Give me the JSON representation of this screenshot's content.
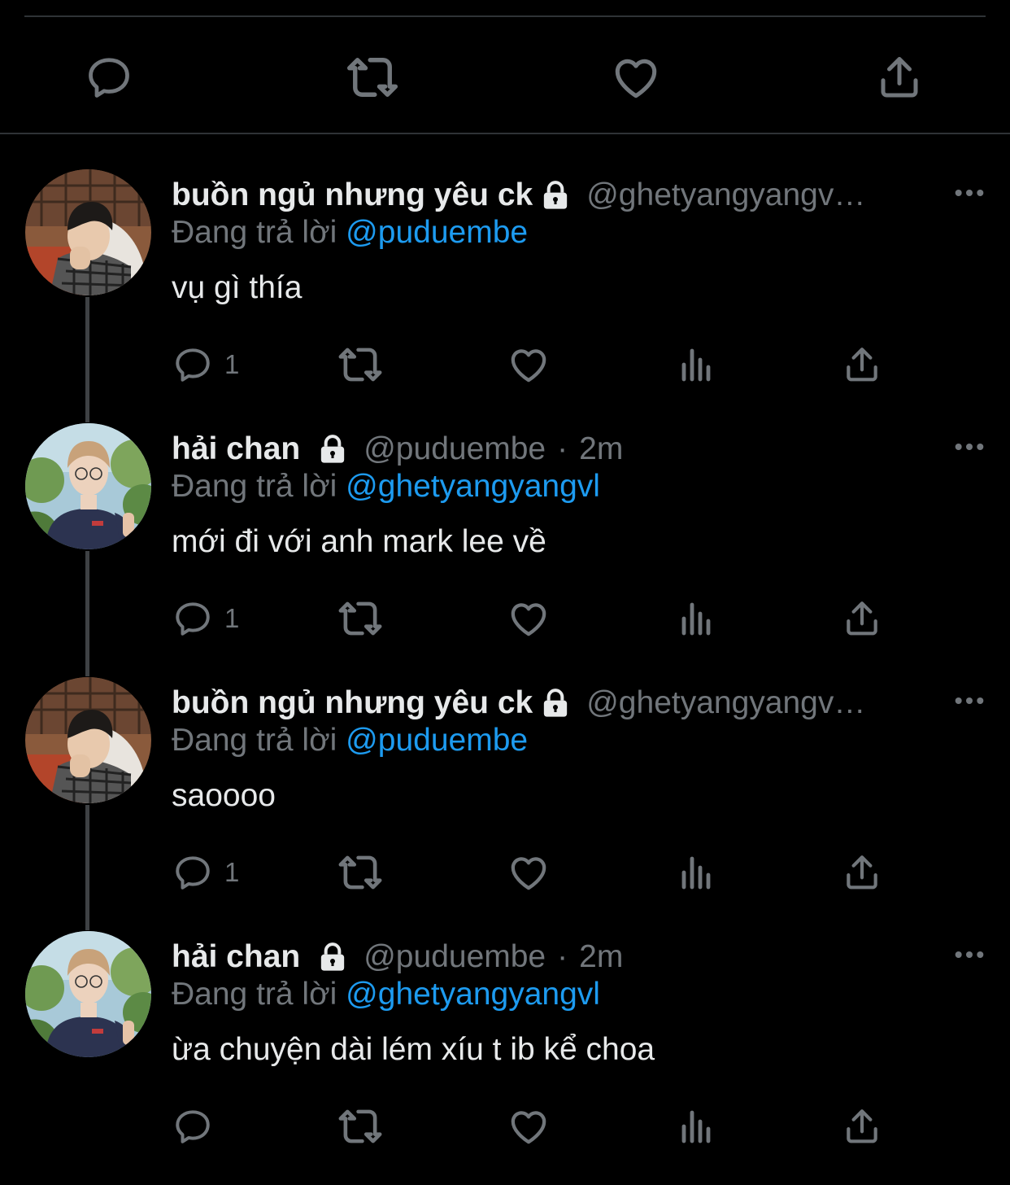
{
  "icons": {
    "reply": "speech-bubble-icon",
    "retweet": "retweet-arrows-icon",
    "like": "heart-icon",
    "views": "bar-chart-icon",
    "share": "share-upload-icon",
    "lock": "padlock-icon",
    "more": "three-dots-icon"
  },
  "colors": {
    "background": "#000000",
    "text": "#e7e9ea",
    "secondary": "#71767b",
    "accent": "#1d9bf0"
  },
  "tweets": [
    {
      "name": "buồn ngủ nhưng yêu ck",
      "handle": "@ghetyangyangv…",
      "dot": "",
      "time": "",
      "reply_prefix": "Đang trả lời",
      "reply_to": "@puduembe",
      "text": "vụ gì thía",
      "reply_count": "1"
    },
    {
      "name": "hải chan",
      "handle": "@puduembe",
      "dot": "·",
      "time": "2m",
      "reply_prefix": "Đang trả lời",
      "reply_to": "@ghetyangyangvl",
      "text": "mới đi với anh mark lee về",
      "reply_count": "1"
    },
    {
      "name": "buồn ngủ nhưng yêu ck",
      "handle": "@ghetyangyangv…",
      "dot": "",
      "time": "",
      "reply_prefix": "Đang trả lời",
      "reply_to": "@puduembe",
      "text": "saoooo",
      "reply_count": "1"
    },
    {
      "name": "hải chan",
      "handle": "@puduembe",
      "dot": "·",
      "time": "2m",
      "reply_prefix": "Đang trả lời",
      "reply_to": "@ghetyangyangvl",
      "text": "ừa chuyện dài lém xíu t ib kể choa",
      "reply_count": ""
    }
  ]
}
